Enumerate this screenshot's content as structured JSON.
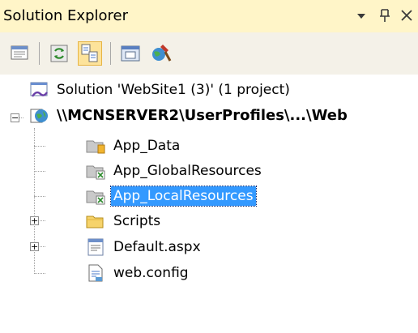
{
  "panel": {
    "title": "Solution Explorer",
    "dropdown_icon": "dropdown-arrow-icon",
    "pin_glyph": "I",
    "close_glyph": "✕"
  },
  "toolbar": {
    "items": [
      {
        "icon": "properties-icon"
      },
      {
        "icon": "refresh-icon"
      },
      {
        "icon": "nest-related-files-icon"
      },
      {
        "icon": "view-designer-icon"
      },
      {
        "icon": "asp-net-configuration-icon"
      }
    ]
  },
  "tree": {
    "solution_label": "Solution 'WebSite1 (3)' (1 project)",
    "project_label": "\\\\MCNSERVER2\\UserProfiles\\...\\Web",
    "items": [
      {
        "label": "App_Data",
        "icon": "special-folder-icon"
      },
      {
        "label": "App_GlobalResources",
        "icon": "resources-folder-icon"
      },
      {
        "label": "App_LocalResources",
        "icon": "resources-folder-icon",
        "selected": true
      },
      {
        "label": "Scripts",
        "icon": "folder-icon"
      },
      {
        "label": "Default.aspx",
        "icon": "aspx-file-icon"
      },
      {
        "label": "web.config",
        "icon": "config-file-icon"
      }
    ]
  },
  "colors": {
    "title_bg": "#fff5c8",
    "toolbar_bg": "#f4f1e8",
    "selection": "#3399ff"
  }
}
